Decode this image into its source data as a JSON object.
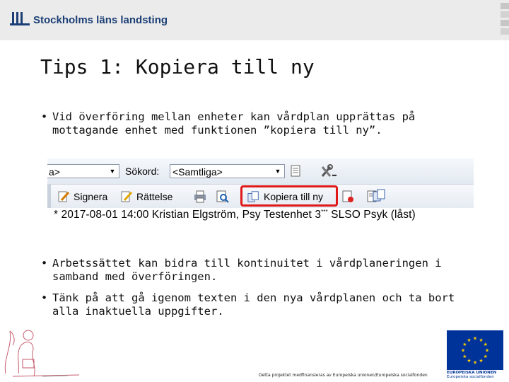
{
  "header": {
    "logo_text": "Stockholms läns landsting"
  },
  "slide": {
    "title": "Tips 1: Kopiera till ny",
    "bullets": [
      "Vid överföring mellan enheter kan vårdplan upprättas på mottagande enhet med funktionen ”kopiera till ny”.",
      "Arbetssättet kan bidra till kontinuitet i vårdplaneringen i samband med överföringen.",
      "Tänk på att gå igenom texten i den nya vårdplanen och ta bort alla inaktuella uppgifter."
    ],
    "bullet_glyph": "•"
  },
  "screenshot": {
    "first_select_value": "a>",
    "search_label": "Sökord:",
    "search_select_value": "<Samtliga>",
    "buttons": {
      "sign": "Signera",
      "correct": "Rättelse",
      "copy": "Kopiera till ny"
    },
    "entry_text": "* 2017-08-01 14:00  Kristian Elgström, Psy  Testenhet 3",
    "entry_sup": "***",
    "entry_tail": " SLSO Psyk   (låst)",
    "highlight_color": "#e01818"
  },
  "footer": {
    "credit": "Detta projektet medfinansieras av Europeiska unionen/Europeiska socialfonden",
    "eu_line1": "EUROPEISKA UNIONEN",
    "eu_line2": "Europeiska socialfonden"
  },
  "colors": {
    "brand": "#1c3f75",
    "eu_blue": "#003399",
    "eu_star": "#ffcc00"
  }
}
